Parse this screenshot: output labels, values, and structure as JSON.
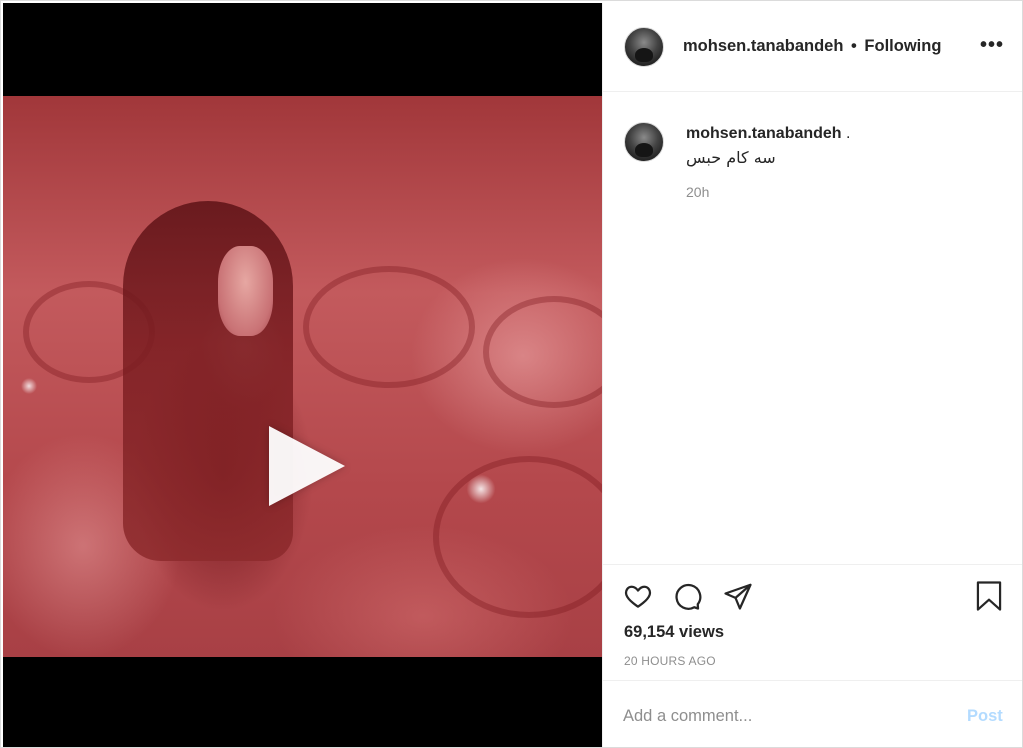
{
  "post": {
    "username": "mohsen.tanabandeh",
    "separator": "•",
    "follow_status": "Following",
    "more_icon": "•••"
  },
  "caption": {
    "username": "mohsen.tanabandeh",
    "trailing": ".",
    "text": "سه کام حبس",
    "time": "20h"
  },
  "stats": {
    "views": "69,154 views",
    "posted_ago": "20 HOURS AGO"
  },
  "comment": {
    "placeholder": "Add a comment...",
    "post_label": "Post"
  },
  "icons": {
    "play": "play-icon",
    "like": "heart-icon",
    "comment": "comment-bubble-icon",
    "share": "paper-plane-icon",
    "save": "bookmark-icon",
    "more": "more-options-icon"
  },
  "colors": {
    "text": "#262626",
    "muted": "#8e8e8e",
    "post_disabled": "#b3dbff",
    "border": "#efefef"
  }
}
